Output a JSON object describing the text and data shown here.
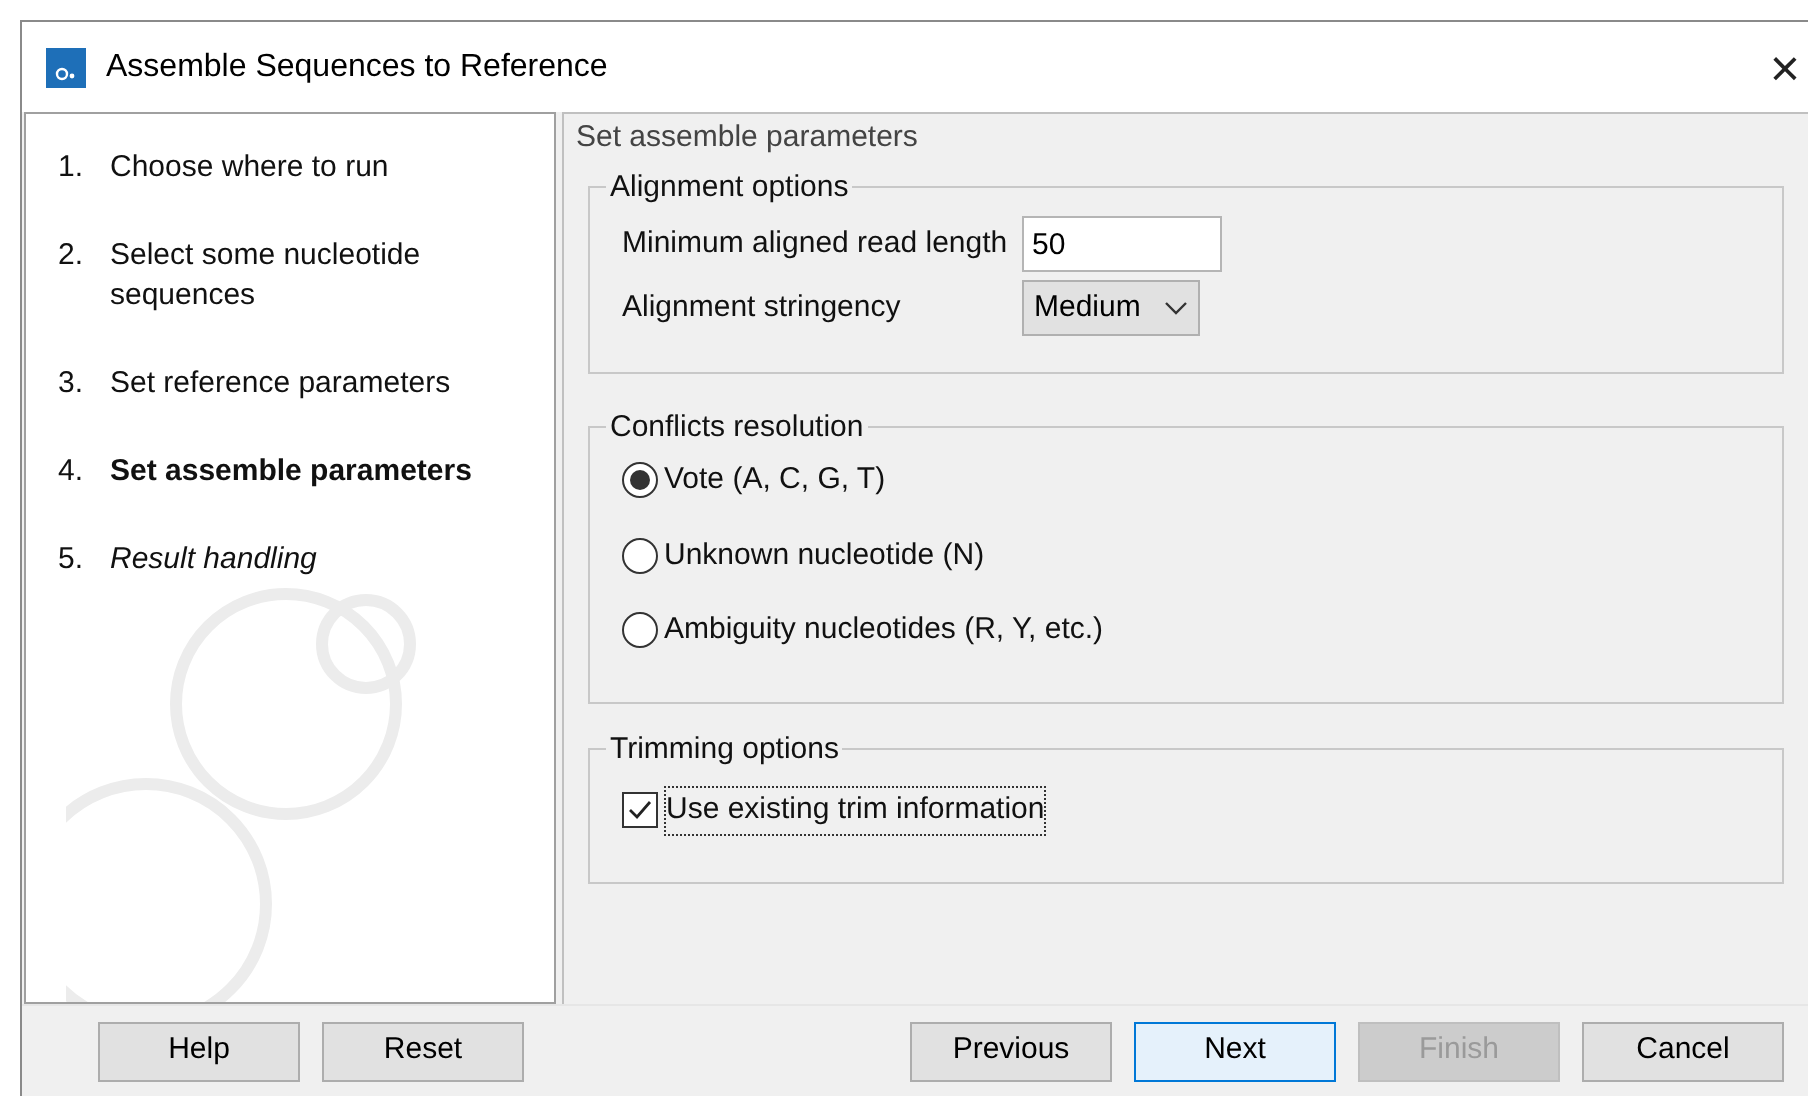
{
  "window": {
    "title": "Assemble Sequences to Reference",
    "close": "×"
  },
  "steps": [
    {
      "number": "1.",
      "label": "Choose where to run",
      "kind": "done"
    },
    {
      "number": "2.",
      "label": "Select some nucleotide sequences",
      "kind": "done"
    },
    {
      "number": "3.",
      "label": "Set reference parameters",
      "kind": "done"
    },
    {
      "number": "4.",
      "label": "Set assemble parameters",
      "kind": "current"
    },
    {
      "number": "5.",
      "label": "Result handling",
      "kind": "pending"
    }
  ],
  "page_title": "Set assemble parameters",
  "alignment": {
    "title": "Alignment options",
    "min_length": {
      "label": "Minimum aligned read length",
      "value": "50"
    },
    "stringency": {
      "label": "Alignment stringency",
      "value": "Medium"
    }
  },
  "conflicts": {
    "title": "Conflicts resolution",
    "options": [
      {
        "label": "Vote (A, C, G, T)",
        "selected": true
      },
      {
        "label": "Unknown nucleotide (N)",
        "selected": false
      },
      {
        "label": "Ambiguity nucleotides (R, Y, etc.)",
        "selected": false
      }
    ]
  },
  "trimming": {
    "title": "Trimming options",
    "option": {
      "label": "Use existing trim information",
      "checked": true,
      "focused": true
    }
  },
  "buttons_left": [
    {
      "label": "Help",
      "disabled": false,
      "default": false
    },
    {
      "label": "Reset",
      "disabled": false,
      "default": false
    }
  ],
  "buttons_right": [
    {
      "label": "Previous",
      "disabled": false,
      "default": false
    },
    {
      "label": "Next",
      "disabled": false,
      "default": true
    },
    {
      "label": "Finish",
      "disabled": true,
      "default": false
    },
    {
      "label": "Cancel",
      "disabled": false,
      "default": false
    }
  ]
}
